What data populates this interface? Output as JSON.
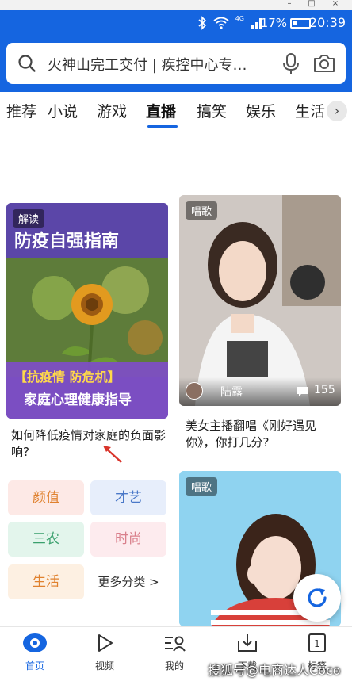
{
  "status_bar": {
    "battery_pct": "17%",
    "time": "20:39",
    "network": "4G"
  },
  "search": {
    "placeholder": "火神山完工交付 | 疾控中心专…"
  },
  "tabs": [
    {
      "label": "推荐"
    },
    {
      "label": "小说"
    },
    {
      "label": "游戏"
    },
    {
      "label": "直播",
      "active": true
    },
    {
      "label": "搞笑"
    },
    {
      "label": "娱乐"
    },
    {
      "label": "生活"
    }
  ],
  "cards": {
    "left": {
      "tag": "解读",
      "poster_title": "防疫自强指南",
      "poster_banner_1": "【抗疫情 防危机】",
      "poster_banner_2": "家庭心理健康指导",
      "title": "如何降低疫情对家庭的负面影响?"
    },
    "right": {
      "tag": "唱歌",
      "streamer": "陆露",
      "viewers": "155",
      "title": "美女主播翻唱《刚好遇见你》，你打几分?"
    },
    "bottom_right": {
      "tag": "唱歌"
    }
  },
  "categories": [
    {
      "label": "颜值"
    },
    {
      "label": "才艺"
    },
    {
      "label": "三农"
    },
    {
      "label": "时尚"
    },
    {
      "label": "生活"
    },
    {
      "label": "更多分类 >"
    }
  ],
  "bottom_nav": [
    {
      "label": "首页",
      "active": true
    },
    {
      "label": "视频"
    },
    {
      "label": "我的"
    },
    {
      "label": "下载"
    },
    {
      "label": "标签"
    }
  ],
  "watermark": "搜狐号@电商达人Coco",
  "colors": {
    "brand_blue": "#1565e0",
    "cat_pink": "#fde9e6",
    "cat_blue": "#e7eefb",
    "cat_green": "#e3f5ec",
    "cat_rose": "#fdebee",
    "cat_orange": "#fdf0e2",
    "cat_text_orange": "#e0812e",
    "cat_text_blue": "#4a78c8",
    "cat_text_green": "#3aa06d",
    "cat_text_rose": "#d9808c"
  }
}
